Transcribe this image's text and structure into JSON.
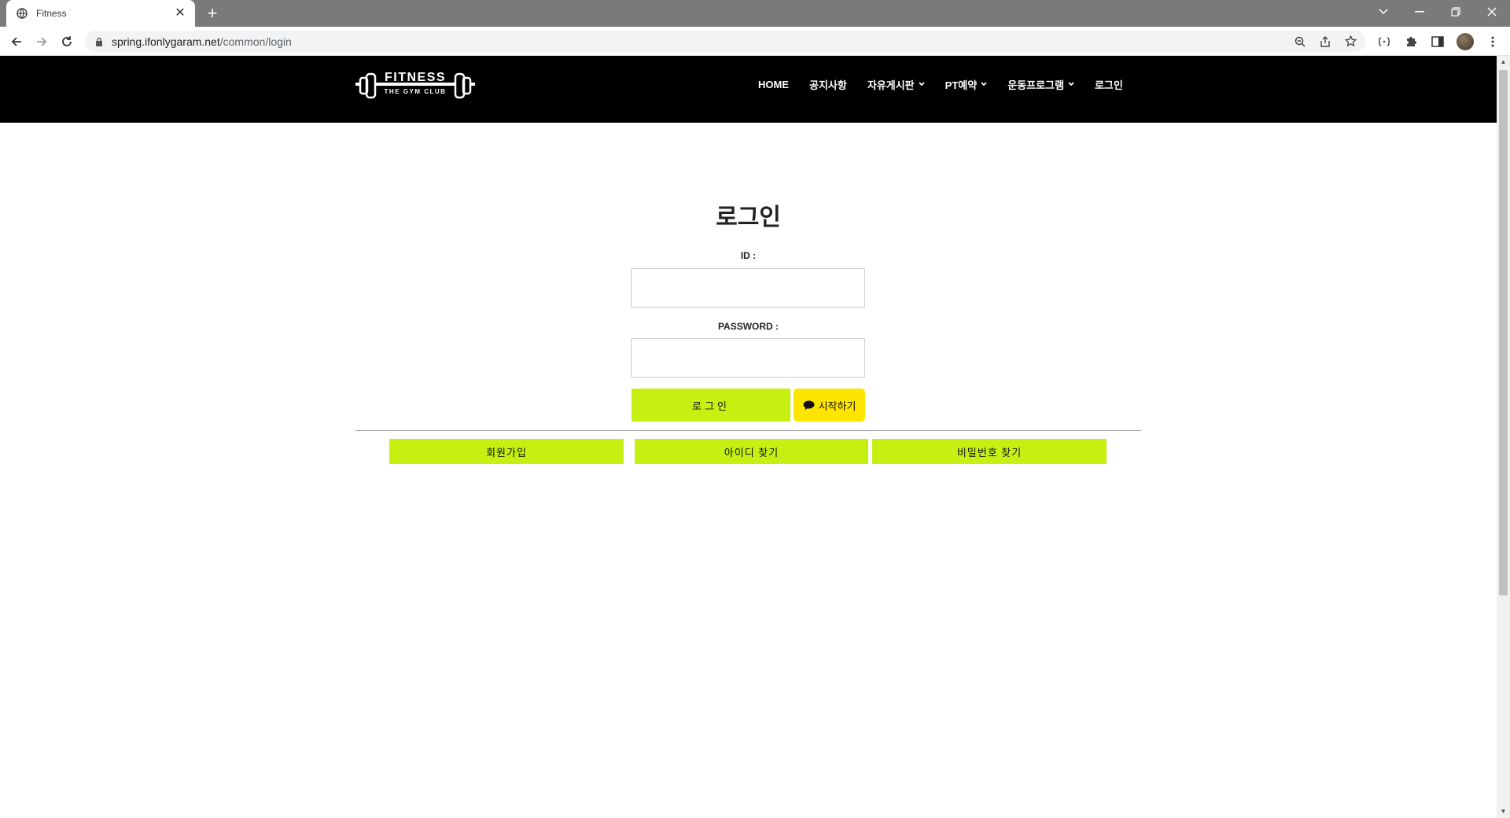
{
  "browser": {
    "tab_title": "Fitness",
    "tab_close": "✕",
    "new_tab": "+",
    "url_host": "spring.ifonlygaram.net",
    "url_path": "/common/login"
  },
  "site": {
    "logo": {
      "main": "FITNESS",
      "sub": "THE GYM CLUB"
    },
    "nav": [
      {
        "label": "HOME",
        "has_dropdown": false
      },
      {
        "label": "공지사항",
        "has_dropdown": false
      },
      {
        "label": "자유게시판",
        "has_dropdown": true
      },
      {
        "label": "PT예약",
        "has_dropdown": true
      },
      {
        "label": "운동프로그램",
        "has_dropdown": true
      },
      {
        "label": "로그인",
        "has_dropdown": false
      }
    ]
  },
  "login": {
    "title": "로그인",
    "id_label": "ID :",
    "id_value": "",
    "password_label": "PASSWORD :",
    "password_value": "",
    "submit_label": "로그인",
    "kakao_label": "시작하기"
  },
  "links": {
    "signup": "회원가입",
    "find_id": "아이디 찾기",
    "find_password": "비밀번호 찾기"
  },
  "colors": {
    "accent": "#c6ef12",
    "kakao": "#fee500",
    "header_bg": "#000000"
  }
}
